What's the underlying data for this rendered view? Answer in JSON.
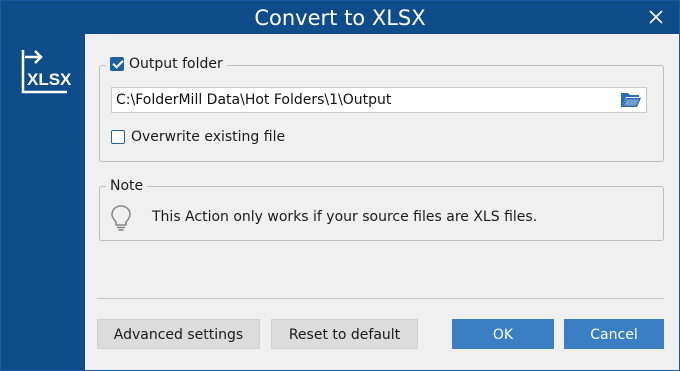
{
  "window": {
    "title": "Convert to XLSX"
  },
  "sidebar": {
    "logo_text": "XLSX",
    "icon": "convert-xlsx-icon"
  },
  "output_group": {
    "legend": "Output folder",
    "enabled": true,
    "path": "C:\\FolderMill Data\\Hot Folders\\1\\Output",
    "overwrite_label": "Overwrite existing file",
    "overwrite_checked": false
  },
  "note_group": {
    "legend": "Note",
    "text": "This Action only works if your source files are XLS files.",
    "icon": "lightbulb-icon"
  },
  "buttons": {
    "advanced": "Advanced settings",
    "reset": "Reset to default",
    "ok": "OK",
    "cancel": "Cancel"
  },
  "colors": {
    "titlebar": "#0f4c8a",
    "accent": "#3a7fc3",
    "content_bg": "#f0f0f0",
    "folder_icon": "#2a6cb3"
  }
}
